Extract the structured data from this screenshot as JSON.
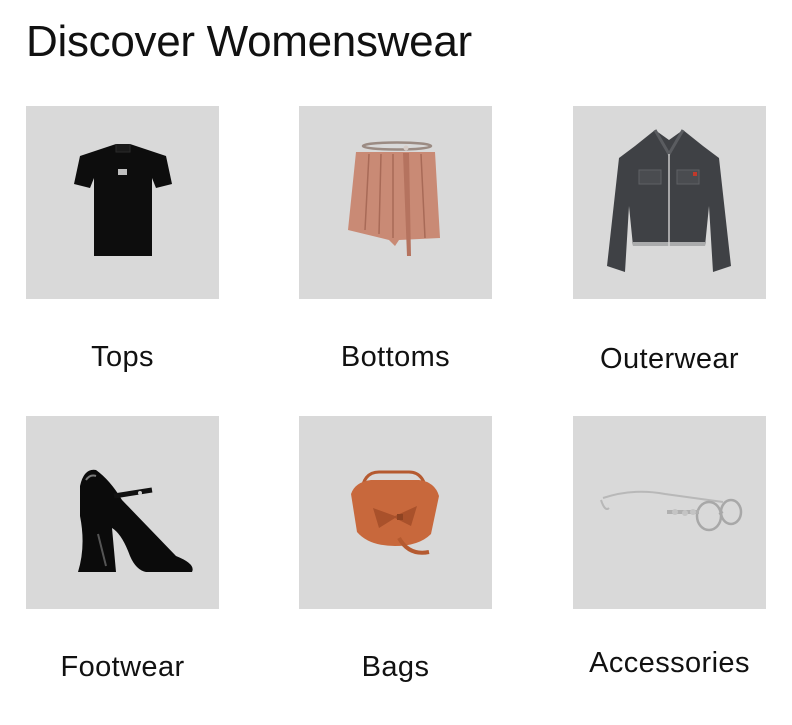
{
  "page": {
    "title": "Discover Womenswear"
  },
  "categories": [
    {
      "label": "Tops",
      "image": "black-short-sleeve-knit-top"
    },
    {
      "label": "Bottoms",
      "image": "pleated-pink-mini-skirt-with-belt"
    },
    {
      "label": "Outerwear",
      "image": "grey-denim-cropped-jacket"
    },
    {
      "label": "Footwear",
      "image": "black-patent-mary-jane-pump"
    },
    {
      "label": "Bags",
      "image": "tan-leather-saddle-bag"
    },
    {
      "label": "Accessories",
      "image": "silver-frame-glasses"
    }
  ],
  "colors": {
    "tile_background": "#d9d9d9",
    "text": "#111111",
    "background": "#ffffff"
  }
}
